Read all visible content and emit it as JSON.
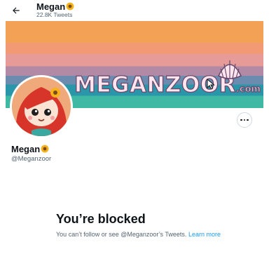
{
  "header": {
    "name": "Megan",
    "tweet_count": "22.8K Tweets",
    "back_icon": "arrow-left-icon"
  },
  "banner": {
    "brand": "MEGANZOOR",
    "brand_suffix": ".com"
  },
  "profile": {
    "display_name": "Megan",
    "name_emoji": "sunflower",
    "handle": "@Meganzoor",
    "more_icon": "more-horizontal-icon"
  },
  "blocked": {
    "title": "You’re blocked",
    "message": "You can’t follow or see @Meganzoor’s Tweets.",
    "link": "Learn more"
  },
  "colors": {
    "accent": "#1d9bf0",
    "text": "#0f1419",
    "secondary_text": "#536471"
  }
}
